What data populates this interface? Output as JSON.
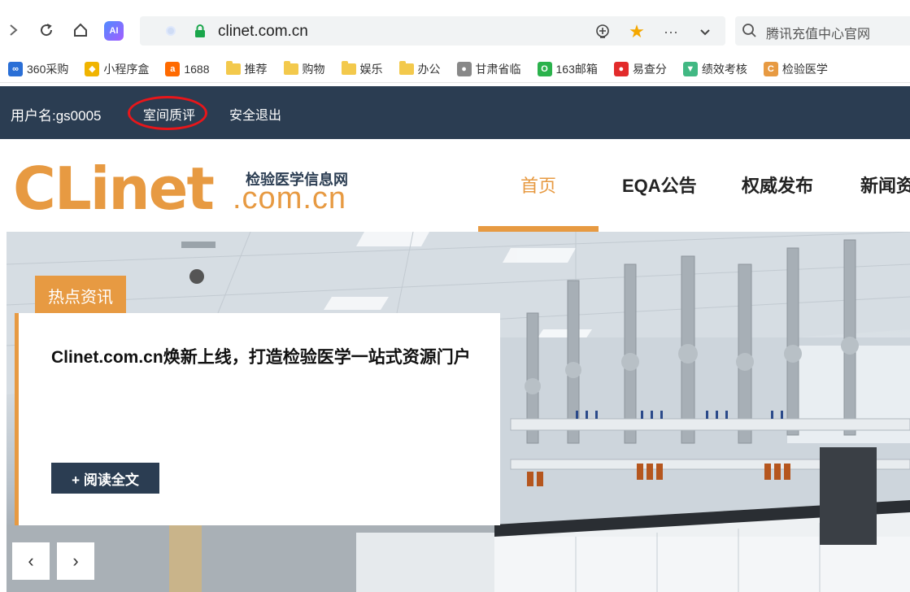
{
  "browser": {
    "ai_label": "AI",
    "url": "clinet.com.cn",
    "search_placeholder": "腾讯充值中心官网"
  },
  "bookmarks": [
    {
      "label": "360采购",
      "icon": "360-icon",
      "color": "#2a6fd6",
      "glyph": "∞"
    },
    {
      "label": "小程序盒",
      "icon": "miniprogram-icon",
      "color": "#f0b400",
      "glyph": "◆"
    },
    {
      "label": "1688",
      "icon": "alibaba-1688-icon",
      "color": "#ff6a00",
      "glyph": "a"
    },
    {
      "label": "推荐",
      "icon": "folder-icon"
    },
    {
      "label": "购物",
      "icon": "folder-icon"
    },
    {
      "label": "娱乐",
      "icon": "folder-icon"
    },
    {
      "label": "办公",
      "icon": "folder-icon"
    },
    {
      "label": "甘肃省临",
      "icon": "globe-icon",
      "color": "#888",
      "glyph": "●"
    },
    {
      "label": "163邮箱",
      "icon": "163-mail-icon",
      "color": "#2bb24c",
      "glyph": "O"
    },
    {
      "label": "易查分",
      "icon": "yichafen-icon",
      "color": "#e22b2b",
      "glyph": "●"
    },
    {
      "label": "绩效考核",
      "icon": "vue-icon",
      "color": "#41b883",
      "glyph": "▼"
    },
    {
      "label": "检验医学",
      "icon": "clinet-icon",
      "color": "#e79a42",
      "glyph": "C"
    }
  ],
  "userbar": {
    "username": "用户名:gs0005",
    "eqa": "室间质评",
    "logout": "安全退出"
  },
  "logo": {
    "main": "CLinet",
    "subtitle": "检验医学信息网",
    "domain": ".com.cn"
  },
  "nav": [
    {
      "label": "首页",
      "active": true
    },
    {
      "label": "EQA公告",
      "active": false
    },
    {
      "label": "权威发布",
      "active": false
    },
    {
      "label": "新闻资",
      "active": false
    }
  ],
  "hero": {
    "tag": "热点资讯",
    "title": "Clinet.com.cn焕新上线，打造检验医学一站式资源门户",
    "read_more": "+ 阅读全文",
    "prev": "‹",
    "next": "›"
  },
  "colors": {
    "accent": "#e79a42",
    "navy": "#2b3d52",
    "highlight_circle": "#e8161a"
  }
}
